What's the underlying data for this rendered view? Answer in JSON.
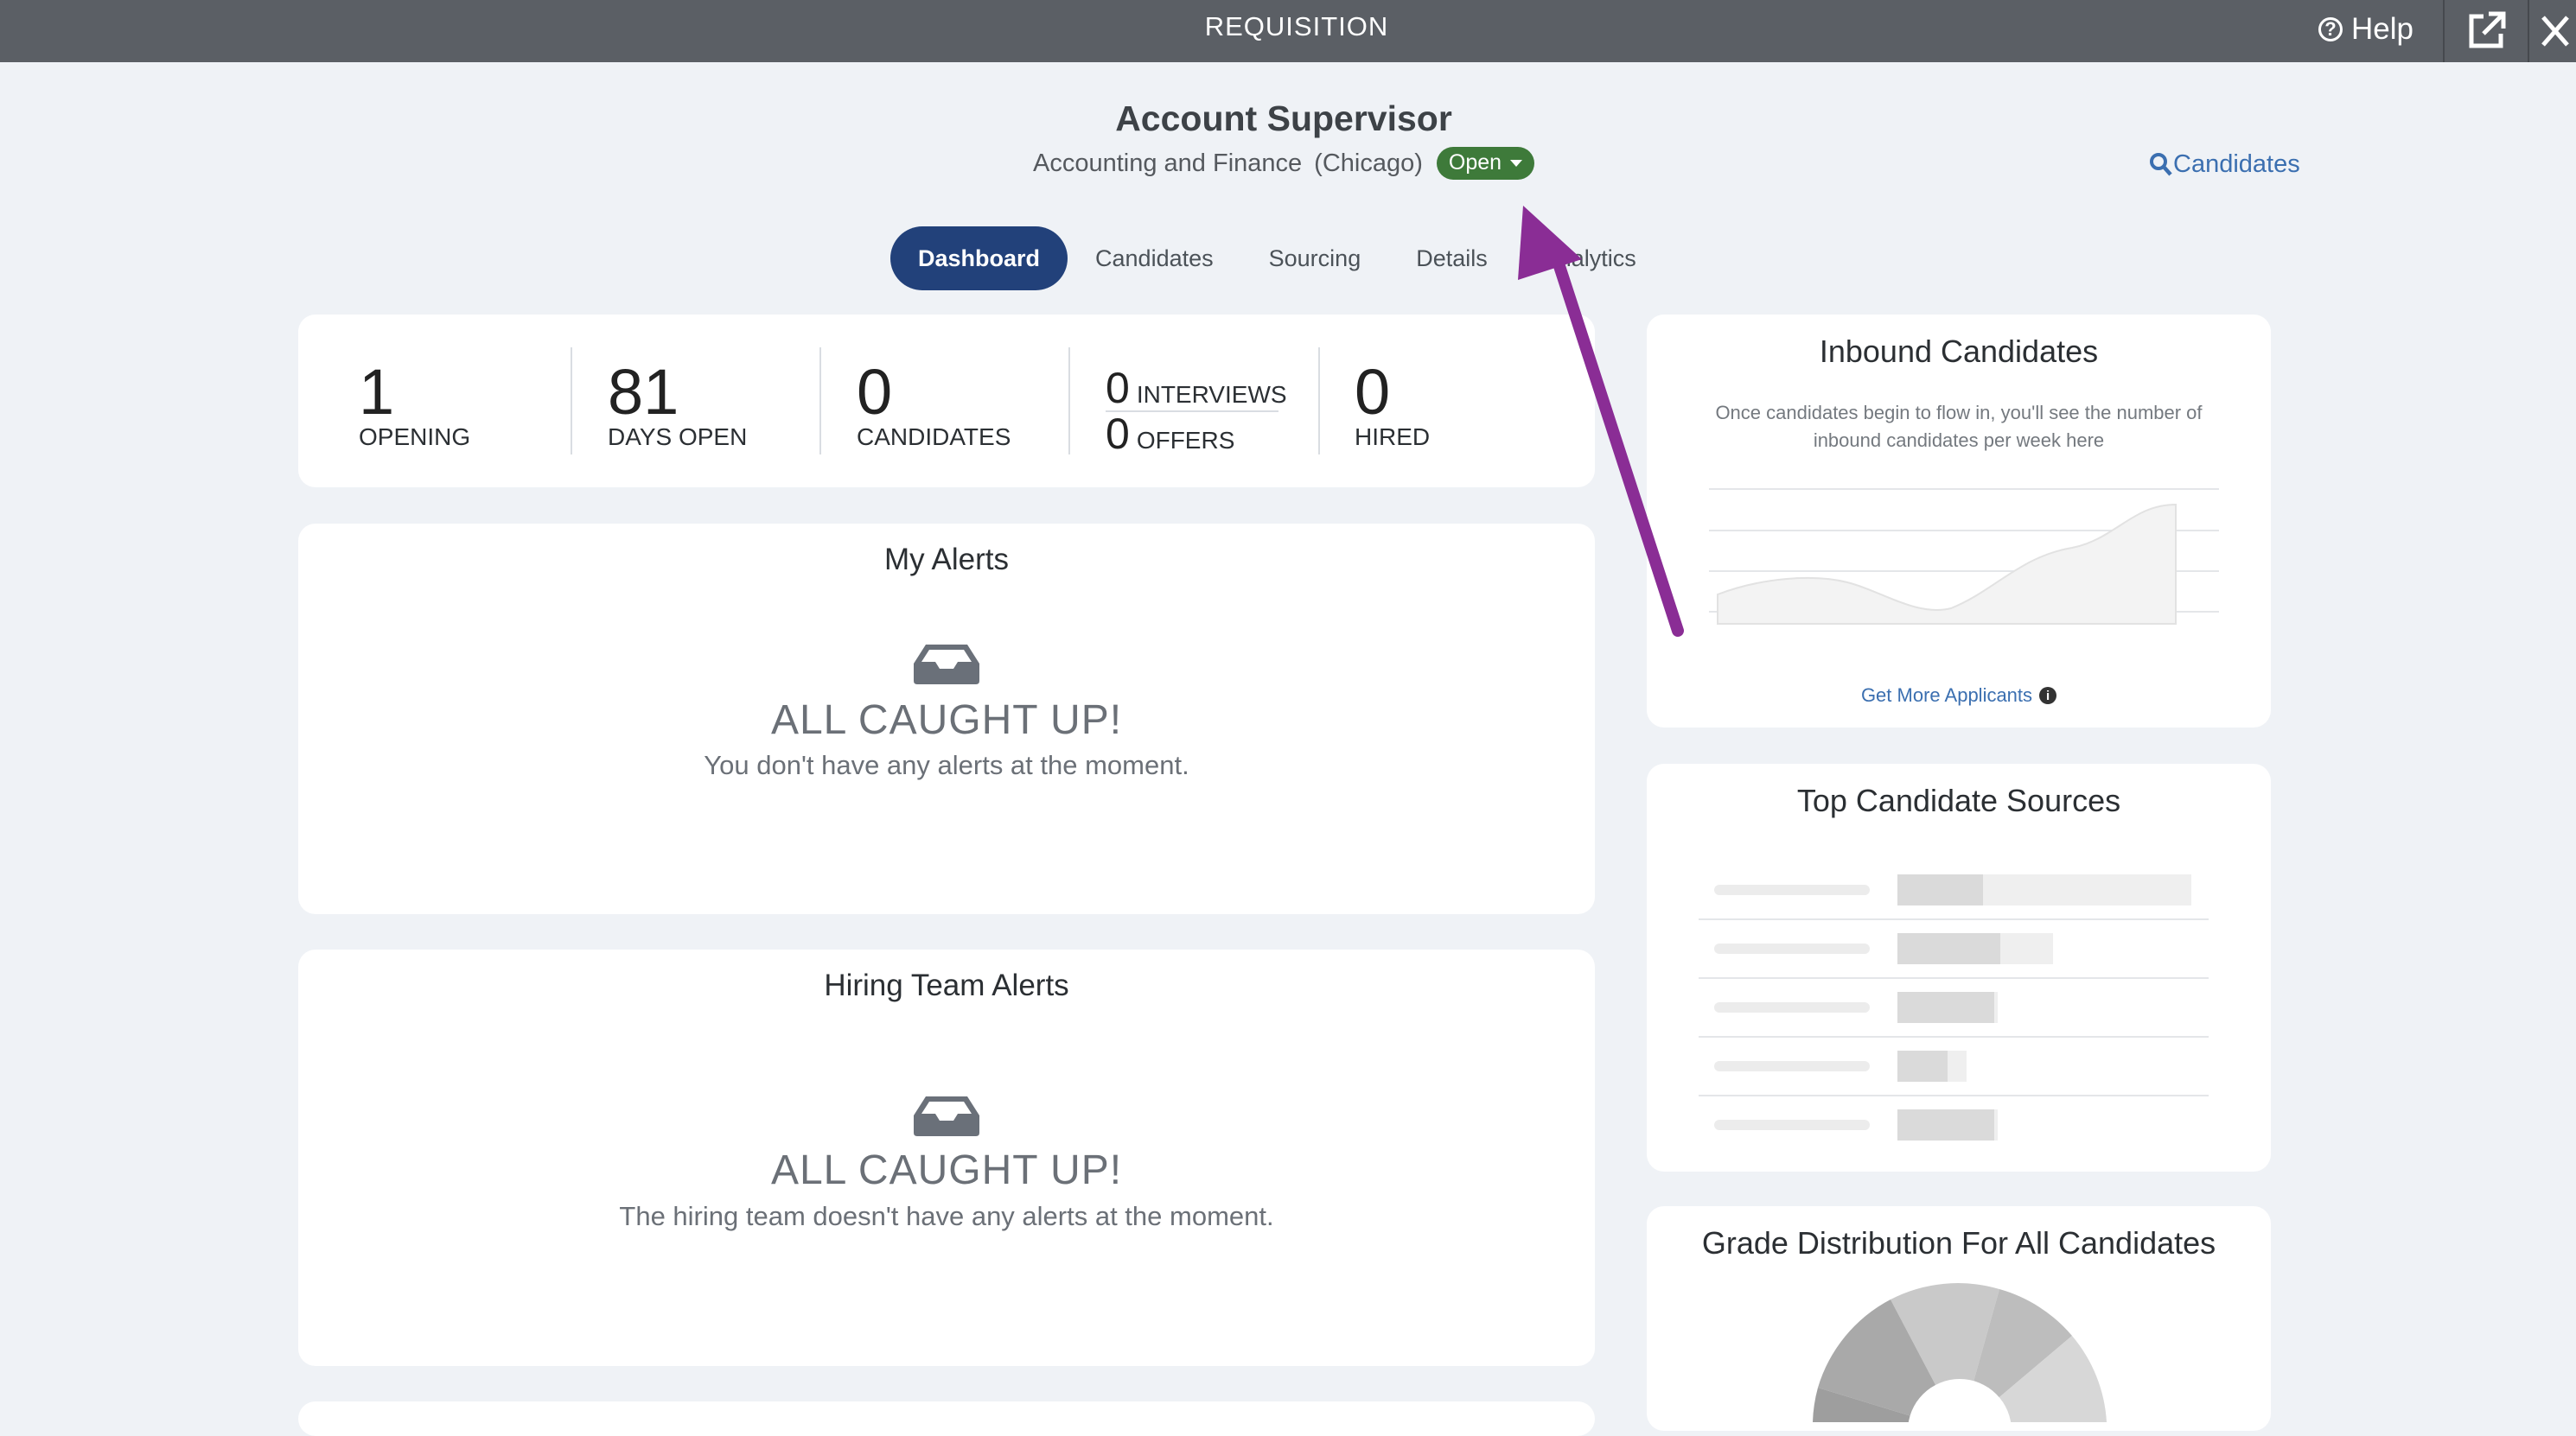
{
  "window": {
    "title": "REQUISITION",
    "help_label": "Help"
  },
  "requisition": {
    "title": "Account Supervisor",
    "department": "Accounting and Finance",
    "location": "(Chicago)",
    "status": "Open"
  },
  "header_link": {
    "candidates_label": "Candidates"
  },
  "tabs": [
    {
      "label": "Dashboard",
      "active": true
    },
    {
      "label": "Candidates"
    },
    {
      "label": "Sourcing"
    },
    {
      "label": "Details"
    },
    {
      "label": "Analytics"
    }
  ],
  "stats": {
    "opening": {
      "value": "1",
      "label": "OPENING"
    },
    "days_open": {
      "value": "81",
      "label": "DAYS OPEN"
    },
    "candidates": {
      "value": "0",
      "label": "CANDIDATES"
    },
    "interviews": {
      "value": "0",
      "label": "INTERVIEWS"
    },
    "offers": {
      "value": "0",
      "label": "OFFERS"
    },
    "hired": {
      "value": "0",
      "label": "HIRED"
    }
  },
  "my_alerts": {
    "title": "My Alerts",
    "headline": "ALL CAUGHT UP!",
    "message": "You don't have any alerts at the moment."
  },
  "hiring_team_alerts": {
    "title": "Hiring Team Alerts",
    "headline": "ALL CAUGHT UP!",
    "message": "The hiring team doesn't have any alerts at the moment."
  },
  "inbound": {
    "title": "Inbound Candidates",
    "description": "Once candidates begin to flow in, you'll see the number of inbound candidates per week here",
    "link": "Get More Applicants"
  },
  "top_sources": {
    "title": "Top Candidate Sources",
    "placeholder_bars": [
      0.29,
      0.35,
      0.33,
      0.17,
      0.33
    ]
  },
  "grade_distribution": {
    "title": "Grade Distribution For All Candidates"
  },
  "colors": {
    "titlebar": "#5b5f65",
    "active_tab": "#22417a",
    "status_open": "#3e7a3a",
    "link": "#3b6fb0",
    "annotation_arrow": "#8a2d95"
  }
}
